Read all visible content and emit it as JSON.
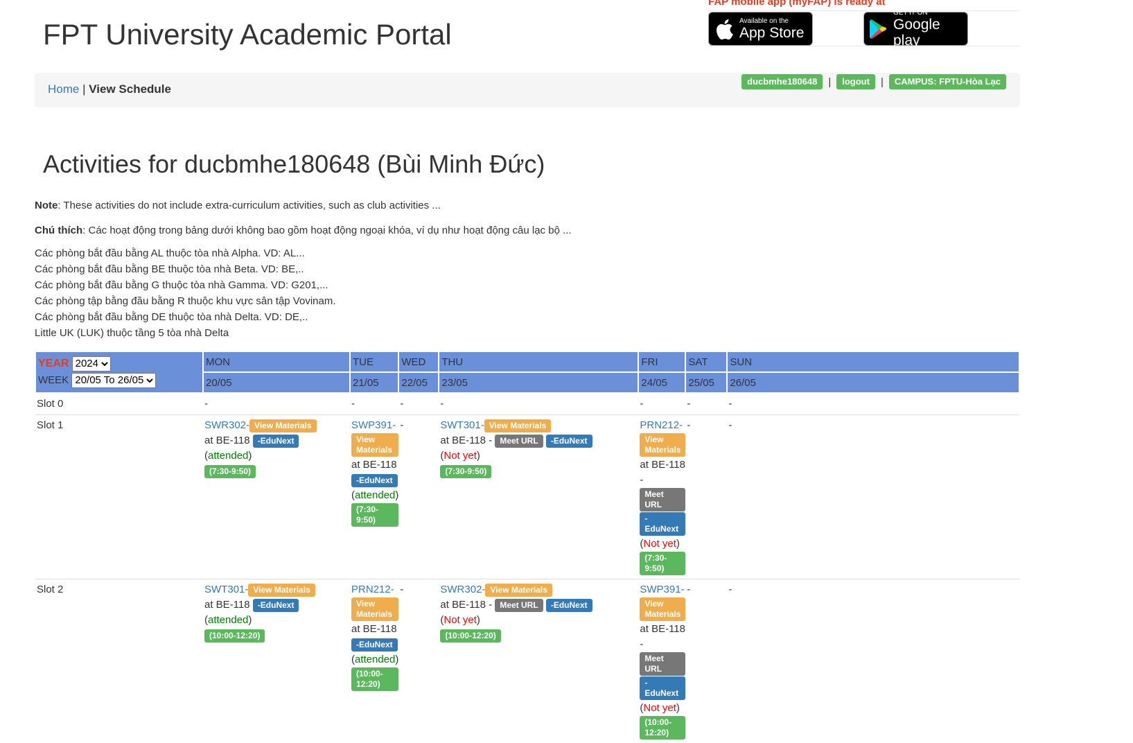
{
  "header": {
    "title": "FPT University Academic Portal",
    "promo_text": "FAP mobile app (myFAP) is ready at",
    "app_store": {
      "small": "Available on the",
      "big": "App Store",
      "icon": "apple-icon"
    },
    "google_play": {
      "small": "GET IT ON",
      "big": "Google play",
      "icon": "google-play-icon"
    }
  },
  "nav": {
    "home": "Home",
    "separator": "|",
    "current": "View Schedule",
    "username": "ducbmhe180648",
    "logout": "logout",
    "campus": "CAMPUS: FPTU-Hòa Lạc"
  },
  "page": {
    "title": "Activities for ducbmhe180648 (Bùi Minh Đức)",
    "note_label": "Note",
    "note_text": ": These activities do not include extra-curriculum activities, such as club activities ...",
    "chuthich_label": "Chú thích",
    "chuthich_text": ": Các hoạt động trong bảng dưới không bao gồm hoạt động ngoại khóa, ví dụ như hoạt động câu lạc bộ ...",
    "building_notes": [
      "Các phòng bắt đầu bằng AL thuộc tòa nhà Alpha. VD: AL...",
      "Các phòng bắt đầu bằng BE thuộc tòa nhà Beta. VD: BE,..",
      "Các phòng bắt đầu bằng G thuộc tòa nhà Gamma. VD: G201,...",
      "Các phòng tập bằng đầu bằng R thuộc khu vực sân tập Vovinam.",
      "Các phòng bắt đầu bằng DE thuộc tòa nhà Delta. VD: DE,..",
      "Little UK (LUK) thuộc tầng 5 tòa nhà Delta"
    ]
  },
  "schedule": {
    "year_label": "YEAR",
    "year_value": "2024",
    "week_label": "WEEK",
    "week_value": "20/05 To 26/05",
    "days": [
      "MON",
      "TUE",
      "WED",
      "THU",
      "FRI",
      "SAT",
      "SUN"
    ],
    "dates": [
      "20/05",
      "21/05",
      "22/05",
      "23/05",
      "24/05",
      "25/05",
      "26/05"
    ],
    "slots": [
      {
        "name": "Slot 0",
        "cells": [
          {
            "empty": "-"
          },
          {
            "empty": "-"
          },
          {
            "empty": "-"
          },
          {
            "empty": "-"
          },
          {
            "empty": "-"
          },
          {
            "empty": "-"
          },
          {
            "empty": "-"
          }
        ]
      },
      {
        "name": "Slot 1",
        "cells": [
          {
            "course": "SWR302-",
            "materials": "View Materials",
            "room": "at BE-118",
            "meet": "",
            "edunext": "-EduNext",
            "status": "attended",
            "time": "(7:30-9:50)"
          },
          {
            "course": "SWP391-",
            "materials": "View Materials",
            "room": "at BE-118",
            "meet": "",
            "edunext": "-EduNext",
            "status": "attended",
            "time": "(7:30-9:50)"
          },
          {
            "empty": "-"
          },
          {
            "course": "SWT301-",
            "materials": "View Materials",
            "room": "at BE-118 -",
            "meet": "Meet URL",
            "edunext": "-EduNext",
            "status": "Not yet",
            "time": "(7:30-9:50)"
          },
          {
            "course": "PRN212-",
            "materials": "View Materials",
            "room": "at BE-118 -",
            "meet": "Meet URL",
            "edunext": "-EduNext",
            "status": "Not yet",
            "time": "(7:30-9:50)"
          },
          {
            "empty": "-"
          },
          {
            "empty": "-"
          }
        ]
      },
      {
        "name": "Slot 2",
        "cells": [
          {
            "course": "SWT301-",
            "materials": "View Materials",
            "room": "at BE-118",
            "meet": "",
            "edunext": "-EduNext",
            "status": "attended",
            "time": "(10:00-12:20)"
          },
          {
            "course": "PRN212-",
            "materials": "View Materials",
            "room": "at BE-118",
            "meet": "",
            "edunext": "-EduNext",
            "status": "attended",
            "time": "(10:00-12:20)"
          },
          {
            "empty": "-"
          },
          {
            "course": "SWR302-",
            "materials": "View Materials",
            "room": "at BE-118 -",
            "meet": "Meet URL",
            "edunext": "-EduNext",
            "status": "Not yet",
            "time": "(10:00-12:20)"
          },
          {
            "course": "SWP391-",
            "materials": "View Materials",
            "room": "at BE-118 -",
            "meet": "Meet URL",
            "edunext": "-EduNext",
            "status": "Not yet",
            "time": "(10:00-12:20)"
          },
          {
            "empty": "-"
          },
          {
            "empty": "-"
          }
        ]
      }
    ]
  }
}
